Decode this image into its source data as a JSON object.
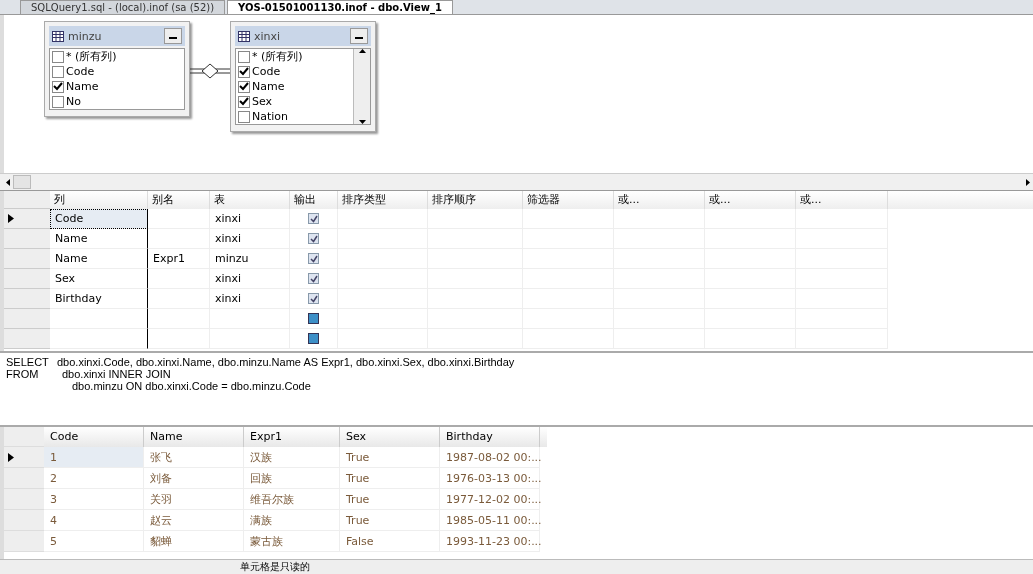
{
  "tabs": [
    {
      "label": "SQLQuery1.sql - (local).inof (sa (52))",
      "selected": false
    },
    {
      "label": "YOS-01501001130.inof - dbo.View_1",
      "selected": true
    }
  ],
  "diagram": {
    "tables": [
      {
        "name": "minzu",
        "columns": [
          {
            "label": "* (所有列)",
            "checked": false
          },
          {
            "label": "Code",
            "checked": false
          },
          {
            "label": "Name",
            "checked": true
          },
          {
            "label": "No",
            "checked": false
          }
        ]
      },
      {
        "name": "xinxi",
        "columns": [
          {
            "label": "* (所有列)",
            "checked": false
          },
          {
            "label": "Code",
            "checked": true
          },
          {
            "label": "Name",
            "checked": true
          },
          {
            "label": "Sex",
            "checked": true
          },
          {
            "label": "Nation",
            "checked": false
          }
        ]
      }
    ]
  },
  "criteria": {
    "columns": [
      "列",
      "别名",
      "表",
      "输出",
      "排序类型",
      "排序顺序",
      "筛选器",
      "或...",
      "或...",
      "或..."
    ],
    "rows": [
      {
        "column": "Code",
        "alias": "",
        "table": "xinxi",
        "output": true,
        "current": true
      },
      {
        "column": "Name",
        "alias": "",
        "table": "xinxi",
        "output": true,
        "current": false
      },
      {
        "column": "Name",
        "alias": "Expr1",
        "table": "minzu",
        "output": true,
        "current": false
      },
      {
        "column": "Sex",
        "alias": "",
        "table": "xinxi",
        "output": true,
        "current": false
      },
      {
        "column": "Birthday",
        "alias": "",
        "table": "xinxi",
        "output": true,
        "current": false
      },
      {
        "column": "",
        "alias": "",
        "table": "",
        "output": false,
        "current": false
      },
      {
        "column": "",
        "alias": "",
        "table": "",
        "output": false,
        "current": false
      }
    ]
  },
  "sql": [
    {
      "keyword": "SELECT",
      "text": "dbo.xinxi.Code, dbo.xinxi.Name, dbo.minzu.Name AS Expr1, dbo.xinxi.Sex, dbo.xinxi.Birthday"
    },
    {
      "keyword": "FROM",
      "text": "dbo.xinxi INNER JOIN"
    },
    {
      "text": "dbo.minzu ON dbo.xinxi.Code = dbo.minzu.Code"
    }
  ],
  "results": {
    "columns": [
      "Code",
      "Name",
      "Expr1",
      "Sex",
      "Birthday"
    ],
    "rows": [
      {
        "cells": [
          "1",
          "张飞",
          "汉族",
          "True",
          "1987-08-02 00:..."
        ],
        "current": true
      },
      {
        "cells": [
          "2",
          "刘备",
          "回族",
          "True",
          "1976-03-13 00:..."
        ],
        "current": false
      },
      {
        "cells": [
          "3",
          "关羽",
          "维吾尔族",
          "True",
          "1977-12-02 00:..."
        ],
        "current": false
      },
      {
        "cells": [
          "4",
          "赵云",
          "满族",
          "True",
          "1985-05-11 00:..."
        ],
        "current": false
      },
      {
        "cells": [
          "5",
          "貂蝉",
          "蒙古族",
          "False",
          "1993-11-23 00:..."
        ],
        "current": false
      }
    ]
  },
  "status_bar": {
    "message": "单元格是只读的"
  }
}
